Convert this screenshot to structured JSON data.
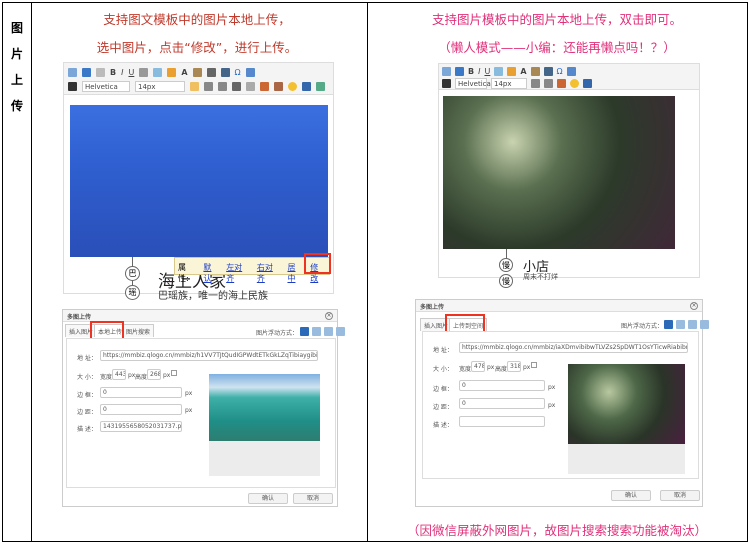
{
  "side_label": [
    "图",
    "片",
    "上",
    "传"
  ],
  "left": {
    "caption1": "支持图文模板中的图片本地上传，",
    "caption2": "选中图片，点击“修改”，进行上传。",
    "toolbar": {
      "font": "Helvetica",
      "size": "14px"
    },
    "popup": {
      "label": "属性:",
      "items": [
        "默认",
        "左对齐",
        "右对齐",
        "居中",
        "修改"
      ]
    },
    "circles": [
      "巴",
      "瑶"
    ],
    "headline": "海上人家",
    "subline": "巴瑶族，唯一的海上民族",
    "dialog": {
      "title": "多图上传",
      "tabs": [
        "插入图片",
        "本地上传",
        "图片搜索"
      ],
      "float_label": "图片浮动方式：",
      "addr_label": "地 址：",
      "addr": "https://mmbiz.qlogo.cn/mmbiz/h1VV7TJtQudIGPWdtETkGkLZqTibiaygibiccOgos",
      "size_label": "大 小：",
      "width_label": "宽度",
      "width": "443",
      "height_label": "高度",
      "height": "268",
      "px": "px",
      "border_label": "边 框：",
      "border": "0",
      "margin_label": "边 距：",
      "margin": "0",
      "desc_label": "描 述：",
      "desc": "1431955658052031737.png",
      "ok": "确认",
      "cancel": "取消"
    }
  },
  "right": {
    "caption1": "支持图片模板中的图片本地上传，双击即可。",
    "caption2": "（懒人模式——小编：还能再懒点吗！？）",
    "toolbar": {
      "font": "Helvetica",
      "size": "14px"
    },
    "circles": [
      "慢",
      "慢"
    ],
    "headline": "小店",
    "subline": "周末不打烊",
    "dialog": {
      "title": "多图上传",
      "tabs": [
        "插入图片",
        "上传到空间"
      ],
      "float_label": "图片浮动方式：",
      "addr_label": "地 址：",
      "addr": "https://mmbiz.qlogo.cn/mmbiz/iaXDmvibibwTLVZs2SpDWT1OsYTicwRiabibmnbi",
      "size_label": "大 小：",
      "width_label": "宽度",
      "width": "478",
      "height_label": "高度",
      "height": "318",
      "px": "px",
      "border_label": "边 框：",
      "border": "0",
      "margin_label": "边 距：",
      "margin": "0",
      "desc_label": "描 述：",
      "desc": "",
      "ok": "确认",
      "cancel": "取消"
    },
    "footnote": "（因微信屏蔽外网图片，故图片搜索搜索功能被淘汰）"
  },
  "colors": {
    "caption_left": "#c0392b",
    "caption_right": "#e0307a",
    "highlight": "#e32222",
    "link": "#1a3cc8"
  }
}
